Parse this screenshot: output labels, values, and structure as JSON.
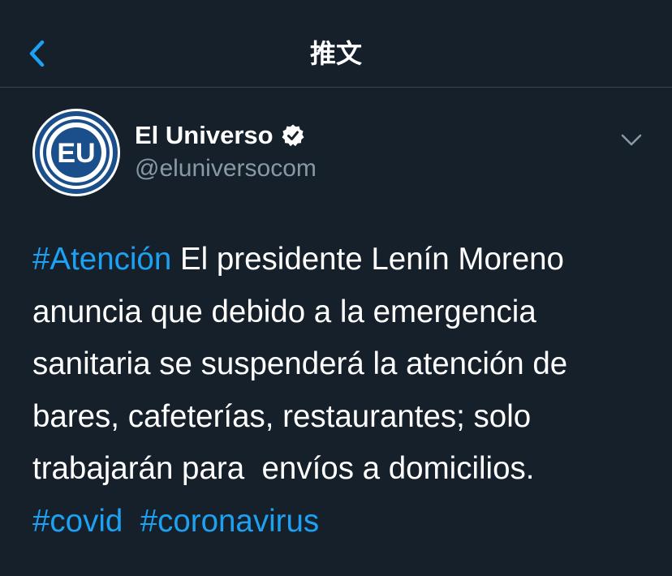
{
  "header": {
    "title": "推文",
    "back_icon": "chevron-left-icon"
  },
  "tweet": {
    "author": {
      "display_name": "El Universo",
      "handle": "@eluniversocom",
      "avatar_text": "EU",
      "verified": true
    },
    "menu_icon": "chevron-down-icon",
    "text_segments": [
      {
        "type": "hashtag",
        "text": "#Atención"
      },
      {
        "type": "text",
        "text": " El presidente Lenín Moreno\nanuncia que debido a la emergencia\nsanitaria se suspenderá la atención de\nbares, cafeterías, restaurantes; solo\ntrabajarán para  envíos a domicilios.\n"
      },
      {
        "type": "hashtag",
        "text": "#covid"
      },
      {
        "type": "text",
        "text": "  "
      },
      {
        "type": "hashtag",
        "text": "#coronavirus"
      }
    ]
  },
  "colors": {
    "background": "#15202b",
    "accent": "#1da1f2",
    "secondary_text": "#8899a6",
    "divider": "#38444d",
    "avatar_ring": "#1a4f8b"
  }
}
